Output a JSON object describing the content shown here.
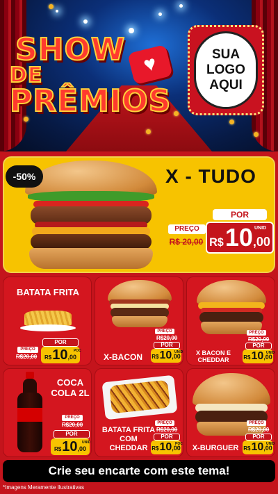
{
  "hero": {
    "title_line1": "SHOW",
    "title_line2": "DE",
    "title_line3": "PRÊMIOS",
    "heart_icon": "heart-icon",
    "logo_line1": "SUA",
    "logo_line2": "LOGO",
    "logo_line3": "AQUI"
  },
  "featured": {
    "discount": "-50%",
    "name": "X - TUDO",
    "por_label": "POR",
    "preco_label": "PREÇO",
    "old_price": "R$ 20,00",
    "currency": "R$",
    "price_int": "10",
    "price_cents": ",00",
    "unit": "UNID"
  },
  "items": [
    {
      "name": "BATATA FRITA",
      "preco_label": "PREÇO",
      "old_price": "R$20,00",
      "por_label": "POR",
      "currency": "R$",
      "price_int": "10",
      "price_cents": ",00",
      "unit": "POC"
    },
    {
      "name": "X-BACON",
      "preco_label": "PREÇO",
      "old_price": "R$20,00",
      "por_label": "POR",
      "currency": "R$",
      "price_int": "10",
      "price_cents": ",00",
      "unit": "UNID"
    },
    {
      "name": "X BACON E CHEDDAR",
      "preco_label": "PREÇO",
      "old_price": "R$20,00",
      "por_label": "POR",
      "currency": "R$",
      "price_int": "10",
      "price_cents": ",00",
      "unit": "UNID"
    },
    {
      "name": "COCA COLA 2L",
      "preco_label": "PREÇO",
      "old_price": "R$20,00",
      "por_label": "POR",
      "currency": "R$",
      "price_int": "10",
      "price_cents": ",00",
      "unit": "UNID"
    },
    {
      "name": "BATATA FRITA COM CHEDDAR",
      "preco_label": "PREÇO",
      "old_price": "R$20,00",
      "por_label": "POR",
      "currency": "R$",
      "price_int": "10",
      "price_cents": ",00",
      "unit": "POC"
    },
    {
      "name": "X-BURGUER",
      "preco_label": "PREÇO",
      "old_price": "R$20,00",
      "por_label": "POR",
      "currency": "R$",
      "price_int": "10",
      "price_cents": ",00",
      "unit": "UNID"
    }
  ],
  "cta": "Crie seu encarte com este tema!",
  "disclaimer": "*Imagens Meramente Ilustrativas",
  "colors": {
    "brand_red": "#c4141c",
    "yellow": "#f7c300",
    "black": "#000000"
  }
}
